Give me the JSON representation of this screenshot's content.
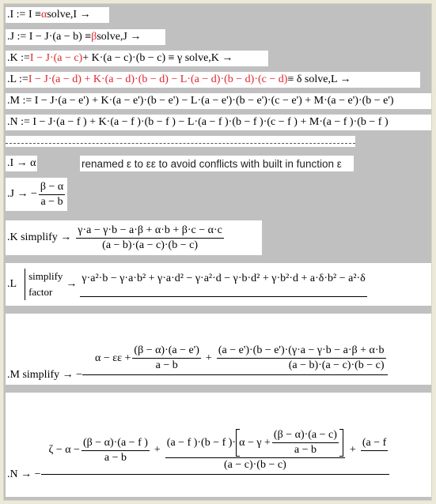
{
  "regions": {
    "r1": {
      "a": ".I := I ≡ ",
      "b": "α",
      "c": " solve,I →"
    },
    "r2": {
      "a": ".J := I − J·(a − b) ≡ ",
      "b": "β",
      "c": " solve,J →"
    },
    "r3": {
      "a": ".K := ",
      "b": "I − J·(a − c)",
      "c": " + K·(a − c)·(b − c) ≡ γ solve,K →"
    },
    "r4": {
      "a": ".L := ",
      "b": "I − J·(a − d) + K·(a − d)·(b − d) − L·(a − d)·(b − d)·(c − d)",
      "c": " ≡ δ solve,L →"
    },
    "r5": ".M := I − J·(a − e') + K·(a − e')·(b − e') − L·(a − e')·(b − e')·(c − e') + M·(a − e')·(b − e')",
    "r6": ".N := I − J·(a − f ) + K·(a − f )·(b − f ) − L·(a − f )·(b − f )·(c − f ) + M·(a − f )·(b − f )",
    "r8": ".I → α",
    "note": "renamed ε to εε to avoid conflicts with built in function ε",
    "j": {
      "lhs": ".J → −",
      "num": "β − α",
      "den": "a − b"
    },
    "k": {
      "lhs": ".K simplify  →",
      "num": "γ·a − γ·b − a·β + α·b + β·c − α·c",
      "den": "(a − b)·(a − c)·(b − c)"
    },
    "l": {
      "lhs": ".L",
      "kw1": "simplify",
      "kw2": "factor",
      "arrow": "→",
      "num": "γ·a²·b − γ·a·b² + γ·a·d² − γ·a²·d − γ·b·d² + γ·b²·d + a·δ·b² − a²·δ"
    },
    "m": {
      "lhs": ".M simplify  → −",
      "t1": "α − εε +",
      "f1n": "(β − α)·(a − e')",
      "f1d": "a − b",
      "plus": "+",
      "f2n": "(a − e')·(b − e')·(γ·a − γ·b − a·β + α·b",
      "f2d": "(a − b)·(a − c)·(b − c)"
    },
    "n": {
      "lhs": ".N → −",
      "t1": "ζ − α −",
      "f1n": "(β − α)·(a − f )",
      "f1d": "a − b",
      "plus": "+",
      "f2pre": "(a − f )·(b − f )·",
      "inner": "α − γ +",
      "f3n": "(β − α)·(a − c)",
      "f3d": "a − b",
      "f2d": "(a − c)·(b − c)",
      "plus2": "+",
      "tail": "(a − f"
    }
  },
  "colors": {
    "highlight": "#e0242a",
    "background": "#c0c0c0",
    "region": "#ffffff"
  }
}
